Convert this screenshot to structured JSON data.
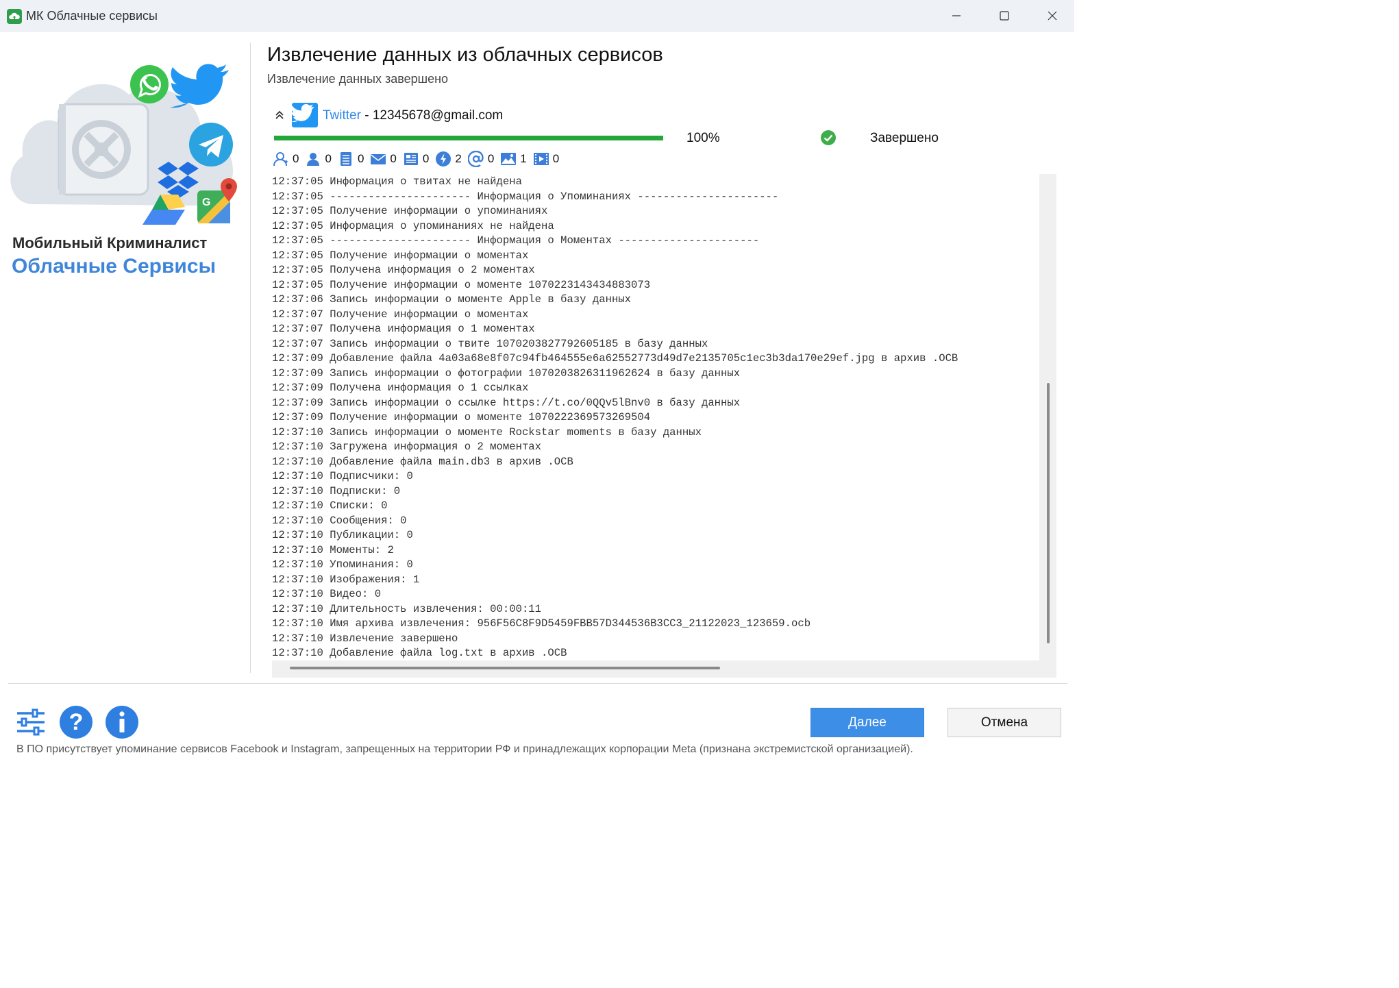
{
  "window": {
    "title": "МК Облачные сервисы"
  },
  "brand": {
    "line1": "Мобильный Криминалист",
    "line2": "Облачные Сервисы"
  },
  "header": {
    "title": "Извлечение данных из облачных сервисов",
    "subtitle": "Извлечение данных завершено"
  },
  "service": {
    "name": "Twitter",
    "separator": " - ",
    "account": "12345678@gmail.com",
    "progress": 1.0,
    "progress_label": "100%",
    "status": "Завершено",
    "status_color": "#25a639"
  },
  "counters": [
    {
      "icon": "followers-icon",
      "value": "0"
    },
    {
      "icon": "following-icon",
      "value": "0"
    },
    {
      "icon": "lists-icon",
      "value": "0"
    },
    {
      "icon": "messages-icon",
      "value": "0"
    },
    {
      "icon": "publications-icon",
      "value": "0"
    },
    {
      "icon": "moments-icon",
      "value": "2"
    },
    {
      "icon": "mentions-icon",
      "value": "0"
    },
    {
      "icon": "images-icon",
      "value": "1"
    },
    {
      "icon": "video-icon",
      "value": "0"
    }
  ],
  "log": [
    "12:37:05 Информация о твитах не найдена",
    "12:37:05 ---------------------- Информация о Упоминаниях ----------------------",
    "12:37:05 Получение информации о упоминаниях",
    "12:37:05 Информация о упоминаниях не найдена",
    "12:37:05 ---------------------- Информация о Моментах ----------------------",
    "12:37:05 Получение информации о моментах",
    "12:37:05 Получена информация о 2 моментах",
    "12:37:05 Получение информации о моменте 1070223143434883073",
    "12:37:06 Запись информации о моменте Apple в базу данных",
    "12:37:07 Получение информации о моментах",
    "12:37:07 Получена информация о 1 моментах",
    "12:37:07 Запись информации о твите 1070203827792605185 в базу данных",
    "12:37:09 Добавление файла 4a03a68e8f07c94fb464555e6a62552773d49d7e2135705c1ec3b3da170e29ef.jpg в архив .OCB",
    "12:37:09 Запись информации о фотографии 1070203826311962624 в базу данных",
    "12:37:09 Получена информация о 1 ссылках",
    "12:37:09 Запись информации о ссылке https://t.co/0QQv5lBnv0 в базу данных",
    "12:37:09 Получение информации о моменте 1070222369573269504",
    "12:37:10 Запись информации о моменте Rockstar moments в базу данных",
    "12:37:10 Загружена информация о 2 моментах",
    "12:37:10 Добавление файла main.db3 в архив .OCB",
    "12:37:10 Подписчики: 0",
    "12:37:10 Подписки: 0",
    "12:37:10 Списки: 0",
    "12:37:10 Сообщения: 0",
    "12:37:10 Публикации: 0",
    "12:37:10 Моменты: 2",
    "12:37:10 Упоминания: 0",
    "12:37:10 Изображения: 1",
    "12:37:10 Видео: 0",
    "12:37:10 Длительность извлечения: 00:00:11",
    "12:37:10 Имя архива извлечения: 956F56C8F9D5459FBB57D344536B3CC3_21122023_123659.ocb",
    "12:37:10 Извлечение завершено",
    "12:37:10 Добавление файла log.txt в архив .OCB"
  ],
  "footer": {
    "next_label": "Далее",
    "cancel_label": "Отмена",
    "disclaimer": "В ПО присутствует упоминание сервисов Facebook и Instagram, запрещенных на территории РФ и принадлежащих корпорации Meta (признана экстремистской организацией).",
    "accent_color": "#3d8ee6"
  }
}
